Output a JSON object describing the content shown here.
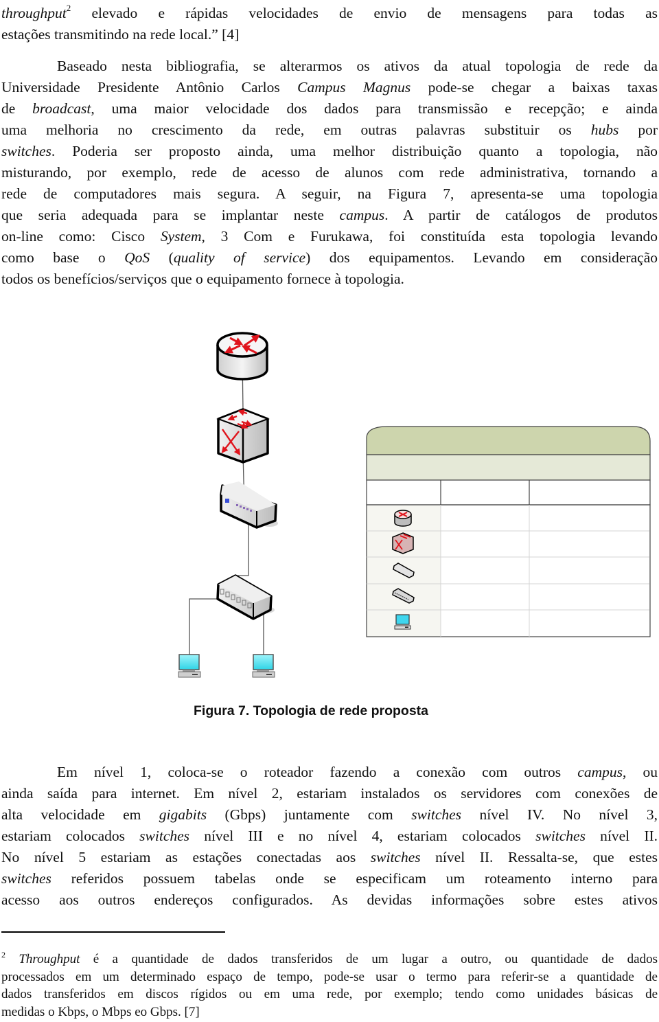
{
  "paragraph1": {
    "lines": [
      {
        "italic_lead": "throughput",
        "sup": "2",
        "text": " elevado e rápidas velocidades de envio de mensagens para todas as"
      },
      {
        "text": "estações transmitindo na rede local.” [4]"
      }
    ]
  },
  "paragraph2": {
    "l1": "Baseado nesta bibliografia, se alterarmos os ativos da atual topologia de rede da",
    "l2a": "Universidade Presidente Antônio Carlos ",
    "l2i": "Campus Magnus",
    "l2b": " pode-se chegar a baixas taxas",
    "l3a": "de ",
    "l3i": "broadcast",
    "l3b": ", uma maior velocidade dos dados para transmissão e recepção; e ainda",
    "l4a": "uma melhoria no crescimento da rede, em outras palavras substituir os ",
    "l4i": "hubs",
    "l4b": " por",
    "l5i": "switches",
    "l5b": ". Poderia ser proposto ainda, uma melhor distribuição quanto a topologia, não",
    "l6": "misturando, por exemplo, rede de acesso de alunos com rede administrativa, tornando a",
    "l7": "rede de computadores mais segura. A seguir, na Figura 7, apresenta-se uma topologia",
    "l8a": "que seria adequada para se implantar neste ",
    "l8i": "campus",
    "l8b": ". A partir de catálogos de produtos",
    "l9a": "on-line como: Cisco ",
    "l9i": "System",
    "l9b": ", 3 Com e Furukawa, foi constituída esta topologia levando",
    "l10a": "como base o ",
    "l10i1": "QoS",
    "l10b": " (",
    "l10i2": "quality of service",
    "l10c": ") dos equipamentos. Levando em consideração",
    "l11": "todos os benefícios/serviços que o equipamento fornece à topologia."
  },
  "figure": {
    "caption": "Figura 7. Topologia de rede proposta",
    "nodes": [
      {
        "id": "router",
        "icon": "router-icon",
        "level": 1
      },
      {
        "id": "core-switch",
        "icon": "multilayer-switch-icon",
        "level": 2
      },
      {
        "id": "workgroup-switch",
        "icon": "workgroup-switch-icon",
        "level": 3
      },
      {
        "id": "access-switch",
        "icon": "switch-icon",
        "level": 4
      },
      {
        "id": "pc-1",
        "icon": "workstation-icon",
        "level": 5
      },
      {
        "id": "pc-2",
        "icon": "workstation-icon",
        "level": 5
      }
    ],
    "legend": {
      "title": "",
      "subtitle": "",
      "columns": [
        "",
        "",
        ""
      ],
      "rows": [
        {
          "icon": "router-icon",
          "col2": "",
          "col3": ""
        },
        {
          "icon": "multilayer-switch-icon",
          "col2": "",
          "col3": ""
        },
        {
          "icon": "workgroup-switch-icon",
          "col2": "",
          "col3": ""
        },
        {
          "icon": "switch-icon",
          "col2": "",
          "col3": ""
        },
        {
          "icon": "workstation-icon",
          "col2": "",
          "col3": ""
        }
      ],
      "header_color": "#cdd5ad",
      "subheader_color": "#e5e9d7"
    }
  },
  "paragraph3": {
    "l1a": "Em nível 1, coloca-se o roteador fazendo a conexão com outros ",
    "l1i": "campus",
    "l1b": ", ou",
    "l2": "ainda saída para internet. Em nível 2, estariam instalados os servidores com conexões de",
    "l3a": "alta velocidade em ",
    "l3i1": "gigabits",
    "l3b": " (Gbps) juntamente com ",
    "l3i2": "switches",
    "l3c": " nível IV. No nível 3,",
    "l4a": "estariam colocados ",
    "l4i1": "switches",
    "l4b": " nível III e no nível 4, estariam colocados ",
    "l4i2": "switches",
    "l4c": " nível II.",
    "l5a": "No nível 5 estariam as estações conectadas aos ",
    "l5i": "switches",
    "l5b": " nível II. Ressalta-se, que estes",
    "l6i": "switches",
    "l6b": " referidos possuem tabelas onde se especificam um roteamento interno para",
    "l7": "acesso aos outros endereços configurados. As devidas informações sobre estes ativos"
  },
  "footnote": {
    "marker": "2",
    "l1i": "Throughput",
    "l1b": " é a quantidade de dados transferidos de um lugar a outro, ou quantidade de dados",
    "l2": "processados em um determinado espaço de tempo, pode-se usar o termo para referir-se a quantidade de",
    "l3": "dados transferidos em discos rígidos ou em uma rede, por exemplo; tendo como unidades básicas de",
    "l4": "medidas o Kbps, o Mbps eo Gbps. [7]"
  }
}
